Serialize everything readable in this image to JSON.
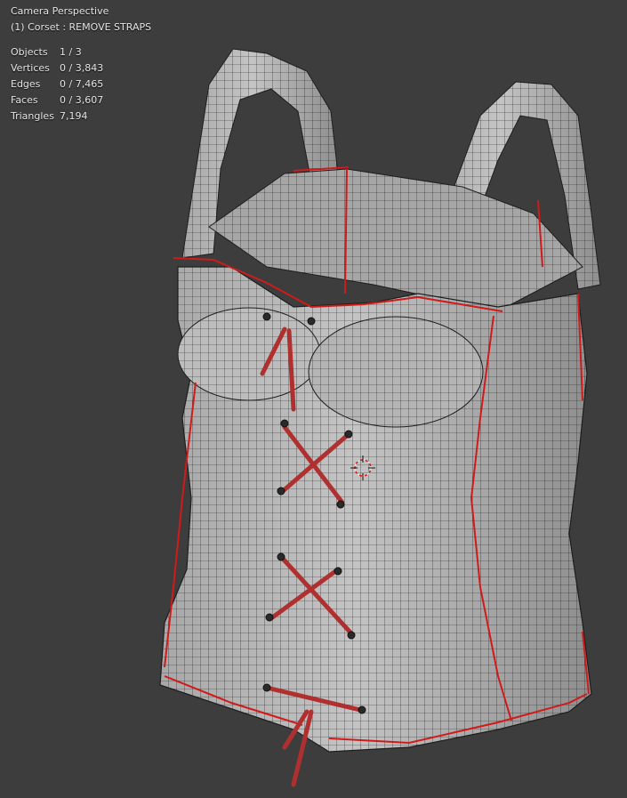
{
  "viewport": {
    "view_name": "Camera Perspective",
    "active_object": "(1) Corset : REMOVE STRAPS"
  },
  "stats": [
    {
      "label": "Objects",
      "value": "1 / 3"
    },
    {
      "label": "Vertices",
      "value": "0 / 3,843"
    },
    {
      "label": "Edges",
      "value": "0 / 7,465"
    },
    {
      "label": "Faces",
      "value": "0 / 3,607"
    },
    {
      "label": "Triangles",
      "value": "7,194"
    }
  ],
  "colors": {
    "background": "#3d3d3d",
    "mesh_fill": "#b9b9b9",
    "wire": "#1e1e1e",
    "seam": "#d11a1a",
    "lace": "#b03030"
  },
  "scene": {
    "object": "corset-mesh",
    "cursor_icon": "3d-cursor-icon"
  }
}
